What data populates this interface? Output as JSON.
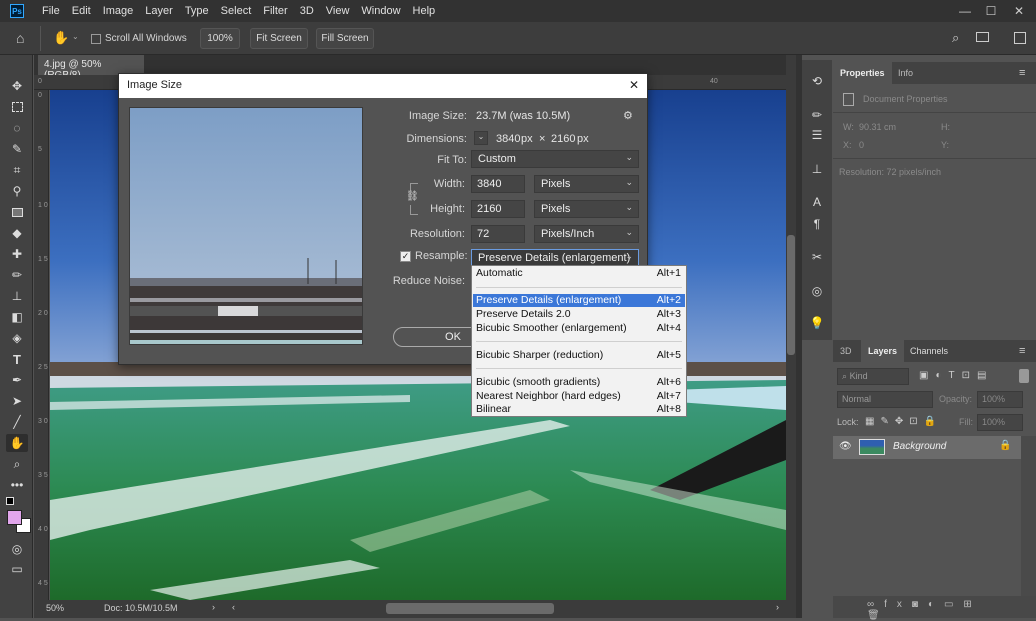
{
  "menubar": {
    "logo": "Ps",
    "items": [
      "File",
      "Edit",
      "Image",
      "Layer",
      "Type",
      "Select",
      "Filter",
      "3D",
      "View",
      "Window",
      "Help"
    ],
    "controls": [
      "—",
      "☐",
      "✕"
    ]
  },
  "optionsbar": {
    "scroll_all_label": "Scroll All Windows",
    "zoom_value": "100%",
    "fit_screen": "Fit Screen",
    "fill_screen": "Fill Screen"
  },
  "document": {
    "tab_title": "4.jpg @ 50% (RGB/8)",
    "zoom": "50%",
    "doc_info": "Doc: 10.5M/10.5M",
    "ruler_h": [
      "0",
      "5",
      "10",
      "15",
      "20",
      "25",
      "30",
      "35",
      "40",
      "45"
    ],
    "ruler_v": [
      "0",
      "5",
      "1 0",
      "1 5",
      "2 0",
      "2 5",
      "3 0",
      "3 5",
      "4 0",
      "4 5",
      "5 0"
    ]
  },
  "dialog": {
    "title": "Image Size",
    "image_size_label": "Image Size:",
    "image_size_value": "23.7M (was 10.5M)",
    "dimensions_label": "Dimensions:",
    "dim_width": "3840",
    "dim_px1": "px",
    "dim_x": "×",
    "dim_height": "2160",
    "dim_px2": "px",
    "fit_to_label": "Fit To:",
    "fit_to_value": "Custom",
    "width_label": "Width:",
    "width_value": "3840",
    "width_unit": "Pixels",
    "height_label": "Height:",
    "height_value": "2160",
    "height_unit": "Pixels",
    "resolution_label": "Resolution:",
    "resolution_value": "72",
    "resolution_unit": "Pixels/Inch",
    "resample_label": "Resample:",
    "resample_checked": true,
    "resample_value": "Preserve Details (enlargement)",
    "reduce_noise_label": "Reduce Noise:",
    "ok_label": "OK",
    "close_icon": "✕"
  },
  "resample_menu": {
    "items": [
      {
        "label": "Automatic",
        "shortcut": "Alt+1",
        "selected": false
      },
      {
        "label": "Preserve Details (enlargement)",
        "shortcut": "Alt+2",
        "selected": true
      },
      {
        "label": "Preserve Details 2.0",
        "shortcut": "Alt+3",
        "selected": false
      },
      {
        "label": "Bicubic Smoother (enlargement)",
        "shortcut": "Alt+4",
        "selected": false
      },
      {
        "label": "Bicubic Sharper (reduction)",
        "shortcut": "Alt+5",
        "selected": false
      },
      {
        "label": "Bicubic (smooth gradients)",
        "shortcut": "Alt+6",
        "selected": false
      },
      {
        "label": "Nearest Neighbor (hard edges)",
        "shortcut": "Alt+7",
        "selected": false
      },
      {
        "label": "Bilinear",
        "shortcut": "Alt+8",
        "selected": false
      }
    ]
  },
  "properties": {
    "tabs": [
      "Properties",
      "Info"
    ],
    "doc_props": "Document Properties",
    "w_label": "W:",
    "w_value": "90.31 cm",
    "h_label": "H:",
    "x_label": "X:",
    "x_value": "0",
    "y_label": "Y:",
    "resolution": "Resolution: 72 pixels/inch"
  },
  "layers_panel": {
    "tabs": [
      "3D",
      "Layers",
      "Channels"
    ],
    "kind_label": "Kind",
    "blend_mode": "Normal",
    "opacity_label": "Opacity:",
    "opacity_value": "100%",
    "lock_label": "Lock:",
    "fill_label": "Fill:",
    "fill_value": "100%",
    "layer_name": "Background"
  },
  "colors": {
    "ui_dark": "#323232",
    "ui_panel": "#535353",
    "highlight": "#3b77d8",
    "foreground_swatch": "#e2a6ec",
    "background_swatch": "#ffffff"
  }
}
